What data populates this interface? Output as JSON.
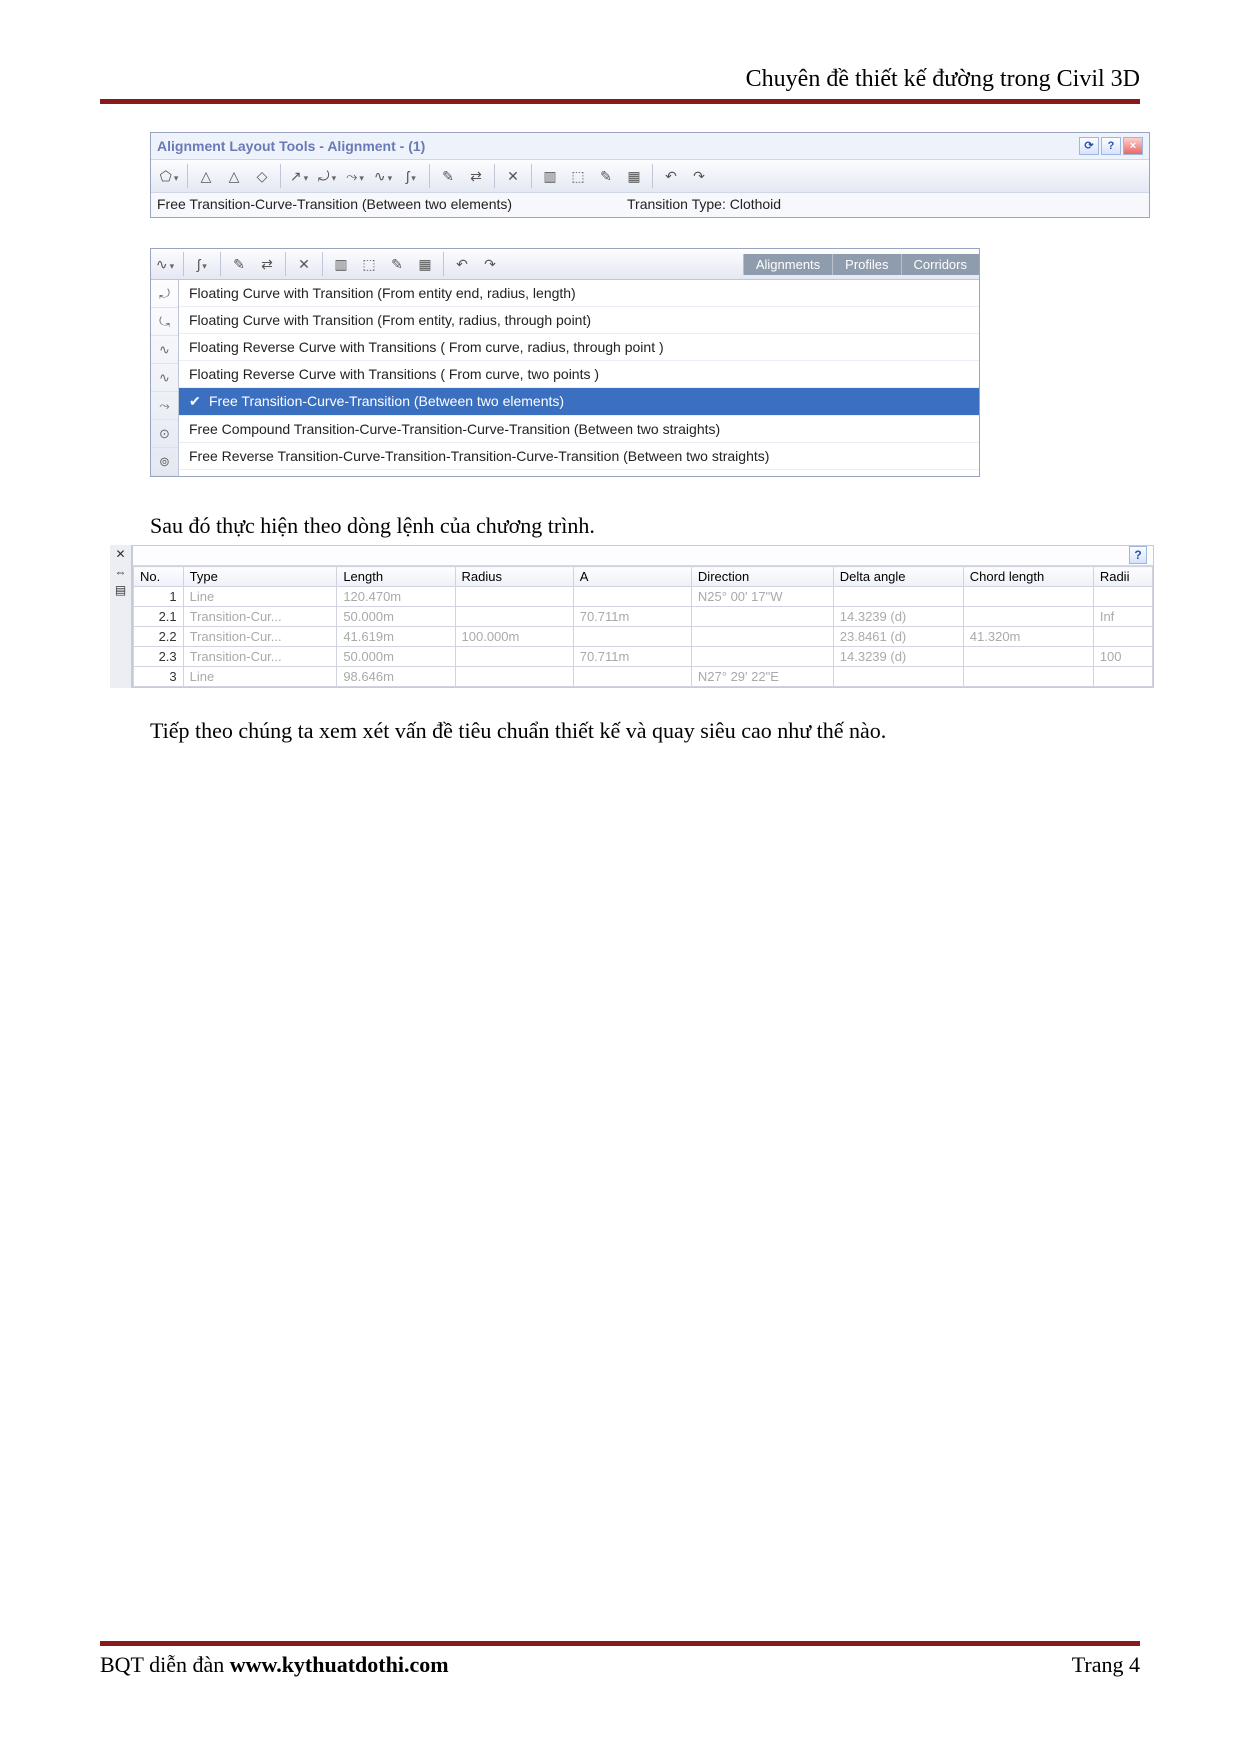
{
  "doc_title": "Chuyên đề thiết kế đường trong Civil 3D",
  "toolbar1": {
    "title": "Alignment Layout Tools - Alignment - (1)",
    "status_left": "Free Transition-Curve-Transition (Between two elements)",
    "status_right": "Transition Type: Clothoid"
  },
  "dropdown": {
    "tabs": [
      "Alignments",
      "Profiles",
      "Corridors"
    ],
    "items": [
      {
        "label": "Floating Curve with Transition (From entity end, radius, length)"
      },
      {
        "label": "Floating Curve with Transition (From entity, radius, through point)"
      },
      {
        "label": "Floating Reverse Curve with Transitions ( From curve, radius, through point )"
      },
      {
        "label": "Floating Reverse Curve with Transitions ( From curve, two points )"
      },
      {
        "label": "Free Transition-Curve-Transition (Between two elements)",
        "selected": true
      },
      {
        "label": "Free Compound Transition-Curve-Transition-Curve-Transition (Between two straights)"
      },
      {
        "label": "Free Reverse Transition-Curve-Transition-Transition-Curve-Transition (Between two straights)"
      }
    ]
  },
  "text1": "Sau đó thực hiện theo dòng lệnh của chương trình.",
  "grid": {
    "headers": [
      "No.",
      "Type",
      "Length",
      "Radius",
      "A",
      "Direction",
      "Delta angle",
      "Chord length",
      "Radii"
    ],
    "rows": [
      {
        "no": "1",
        "type": "Line",
        "length": "120.470m",
        "radius": "",
        "a": "",
        "direction": "N25° 00' 17\"W",
        "delta": "",
        "chord": "",
        "radi": ""
      },
      {
        "no": "2.1",
        "type": "Transition-Cur...",
        "length": "50.000m",
        "radius": "",
        "a": "70.711m",
        "direction": "",
        "delta": "14.3239 (d)",
        "chord": "",
        "radi": "Inf"
      },
      {
        "no": "2.2",
        "type": "Transition-Cur...",
        "length": "41.619m",
        "radius": "100.000m",
        "a": "",
        "direction": "",
        "delta": "23.8461 (d)",
        "chord": "41.320m",
        "radi": ""
      },
      {
        "no": "2.3",
        "type": "Transition-Cur...",
        "length": "50.000m",
        "radius": "",
        "a": "70.711m",
        "direction": "",
        "delta": "14.3239 (d)",
        "chord": "",
        "radi": "100"
      },
      {
        "no": "3",
        "type": "Line",
        "length": "98.646m",
        "radius": "",
        "a": "",
        "direction": "N27° 29' 22\"E",
        "delta": "",
        "chord": "",
        "radi": ""
      }
    ]
  },
  "text2": "Tiếp theo chúng ta xem xét vấn đề tiêu chuẩn thiết kế và quay siêu cao như thế nào.",
  "footer": {
    "left_prefix": "BQT diễn đàn ",
    "left_link": "www.kythuatdothi.com",
    "right": "Trang 4"
  }
}
